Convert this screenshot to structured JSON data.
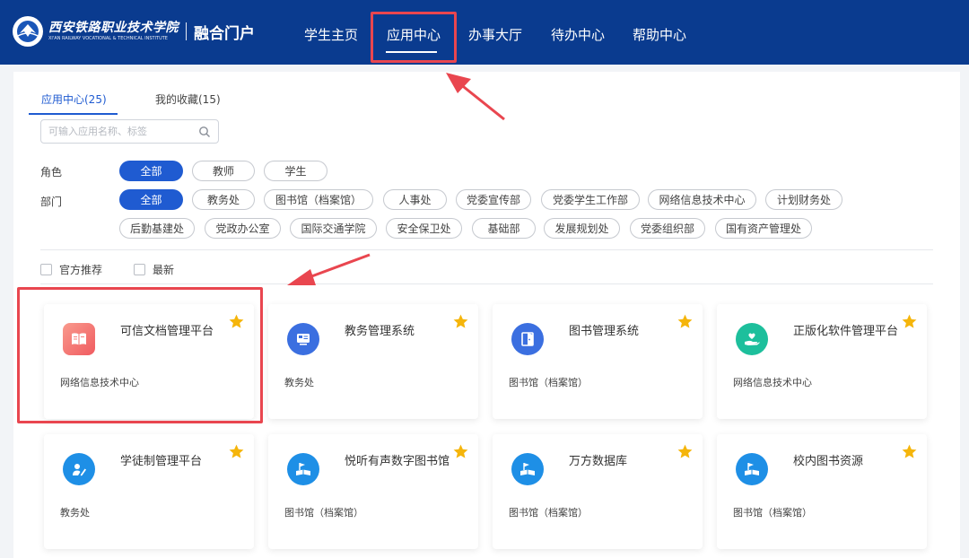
{
  "header": {
    "logo_cn": "西安铁路职业技术学院",
    "logo_en": "XI'AN RAILWAY VOCATIONAL & TECHNICAL INSTITUTE",
    "portal": "融合门户",
    "nav": [
      {
        "label": "学生主页"
      },
      {
        "label": "应用中心"
      },
      {
        "label": "办事大厅"
      },
      {
        "label": "待办中心"
      },
      {
        "label": "帮助中心"
      }
    ],
    "active_nav": "应用中心"
  },
  "tabs": [
    {
      "label": "应用中心(25)",
      "active": true
    },
    {
      "label": "我的收藏(15)",
      "active": false
    }
  ],
  "search": {
    "placeholder": "可输入应用名称、标签",
    "value": ""
  },
  "filters": {
    "role_label": "角色",
    "roles": [
      "全部",
      "教师",
      "学生"
    ],
    "dept_label": "部门",
    "depts_row1": [
      "全部",
      "教务处",
      "图书馆（档案馆）",
      "人事处",
      "党委宣传部",
      "党委学生工作部",
      "网络信息技术中心",
      "计划财务处"
    ],
    "depts_row2": [
      "后勤基建处",
      "党政办公室",
      "国际交通学院",
      "安全保卫处",
      "基础部",
      "发展规划处",
      "党委组织部",
      "国有资产管理处"
    ]
  },
  "checks": [
    "官方推荐",
    "最新"
  ],
  "apps": [
    {
      "name": "可信文档管理平台",
      "dept": "网络信息技术中心",
      "icon": "book-icon",
      "color": "#f3736f"
    },
    {
      "name": "教务管理系统",
      "dept": "教务处",
      "icon": "monitor-icon",
      "color": "#3b6fe0"
    },
    {
      "name": "图书管理系统",
      "dept": "图书馆（档案馆）",
      "icon": "door-icon",
      "color": "#3b6fe0"
    },
    {
      "name": "正版化软件管理平台",
      "dept": "网络信息技术中心",
      "icon": "heart-hand-icon",
      "color": "#1dbf9c"
    },
    {
      "name": "学徒制管理平台",
      "dept": "教务处",
      "icon": "pen-icon",
      "color": "#1e8fe6"
    },
    {
      "name": "悦听有声数字图书馆",
      "dept": "图书馆（档案馆）",
      "icon": "flag-book-icon",
      "color": "#1e8fe6"
    },
    {
      "name": "万方数据库",
      "dept": "图书馆（档案馆）",
      "icon": "flag-book-icon",
      "color": "#1e8fe6"
    },
    {
      "name": "校内图书资源",
      "dept": "图书馆（档案馆）",
      "icon": "flag-book-icon",
      "color": "#1e8fe6"
    }
  ],
  "colors": {
    "header_bg": "#0a3b8f",
    "accent": "#1f5bd1",
    "star": "#f5b50b",
    "annotation": "#e9464f"
  }
}
